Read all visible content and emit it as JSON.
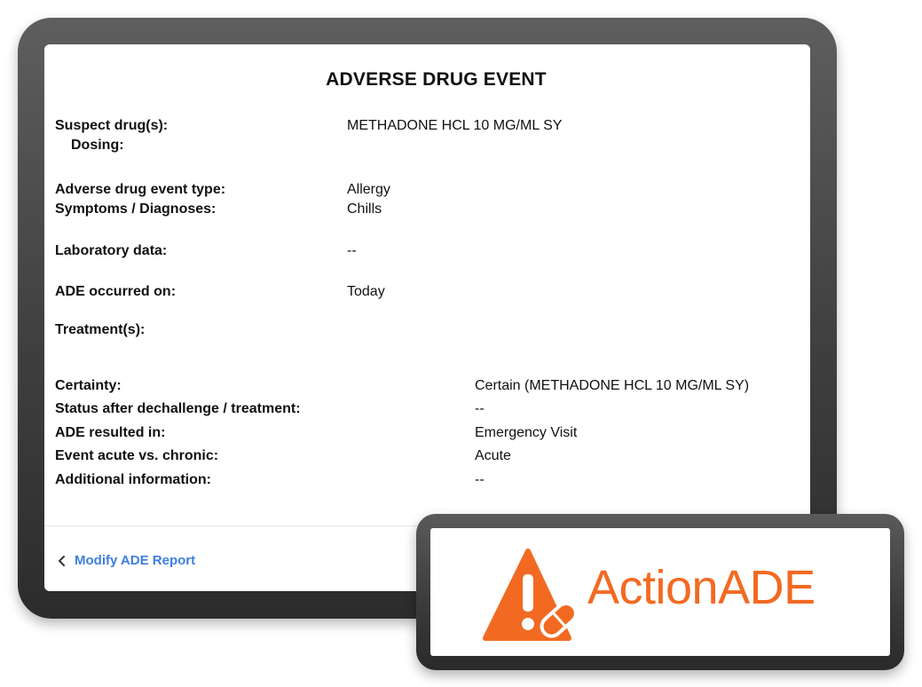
{
  "report": {
    "title": "ADVERSE DRUG EVENT",
    "fields": {
      "suspect_drugs": {
        "label": "Suspect drug(s):",
        "value": "METHADONE HCL 10 MG/ML SY"
      },
      "dosing": {
        "label": "Dosing:",
        "value": ""
      },
      "event_type": {
        "label": "Adverse drug event type:",
        "value": "Allergy"
      },
      "symptoms": {
        "label": "Symptoms / Diagnoses:",
        "value": "Chills"
      },
      "lab_data": {
        "label": "Laboratory data:",
        "value": "--"
      },
      "occurred_on": {
        "label": "ADE occurred on:",
        "value": "Today"
      },
      "treatments": {
        "label": "Treatment(s):",
        "value": ""
      },
      "certainty": {
        "label": "Certainty:",
        "value": "Certain (METHADONE HCL 10 MG/ML SY)"
      },
      "status_after": {
        "label": "Status after dechallenge / treatment:",
        "value": "--"
      },
      "resulted_in": {
        "label": "ADE resulted in:",
        "value": "Emergency Visit"
      },
      "acute_chronic": {
        "label": "Event acute vs. chronic:",
        "value": "Acute"
      },
      "additional_info": {
        "label": "Additional information:",
        "value": "--"
      }
    }
  },
  "footer": {
    "modify_label": "Modify ADE Report",
    "modify_icon": "chevron-left-icon"
  },
  "logo": {
    "text": "ActionADE",
    "icon": "warning-pill-icon",
    "color": "#f26a22"
  },
  "colors": {
    "link": "#3d7ee0",
    "text": "#111111",
    "device_frame": "#3f3f3f"
  }
}
